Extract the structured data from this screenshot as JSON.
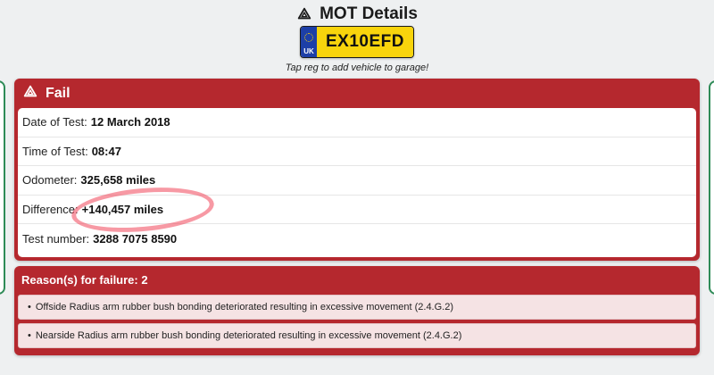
{
  "header": {
    "title": "MOT Details",
    "icon": "warning-triangle-icon"
  },
  "plate": {
    "country": "UK",
    "registration": "EX10EFD",
    "band_color": "#1d3fa7",
    "plate_color": "#f8d40c"
  },
  "hint": "Tap reg to add vehicle to garage!",
  "result": {
    "status": "Fail",
    "accent_color": "#b5282e",
    "rows": [
      {
        "label": "Date of Test:",
        "value": "12 March 2018"
      },
      {
        "label": "Time of Test:",
        "value": "08:47"
      },
      {
        "label": "Odometer:",
        "value": "325,658 miles"
      },
      {
        "label": "Difference:",
        "value": "+140,457 miles"
      },
      {
        "label": "Test number:",
        "value": "3288 7075 8590"
      }
    ]
  },
  "reasons": {
    "title": "Reason(s) for failure: 2",
    "items": [
      "Offside Radius arm rubber bush bonding deteriorated resulting in excessive movement (2.4.G.2)",
      "Nearside Radius arm rubber bush bonding deteriorated resulting in excessive movement (2.4.G.2)"
    ]
  }
}
